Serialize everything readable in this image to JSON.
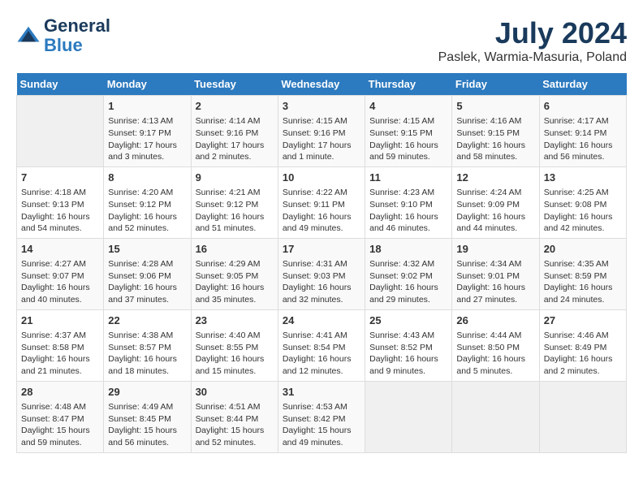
{
  "logo": {
    "line1": "General",
    "line2": "Blue"
  },
  "title": "July 2024",
  "location": "Paslek, Warmia-Masuria, Poland",
  "days_header": [
    "Sunday",
    "Monday",
    "Tuesday",
    "Wednesday",
    "Thursday",
    "Friday",
    "Saturday"
  ],
  "weeks": [
    [
      {
        "day": "",
        "info": ""
      },
      {
        "day": "1",
        "info": "Sunrise: 4:13 AM\nSunset: 9:17 PM\nDaylight: 17 hours\nand 3 minutes."
      },
      {
        "day": "2",
        "info": "Sunrise: 4:14 AM\nSunset: 9:16 PM\nDaylight: 17 hours\nand 2 minutes."
      },
      {
        "day": "3",
        "info": "Sunrise: 4:15 AM\nSunset: 9:16 PM\nDaylight: 17 hours\nand 1 minute."
      },
      {
        "day": "4",
        "info": "Sunrise: 4:15 AM\nSunset: 9:15 PM\nDaylight: 16 hours\nand 59 minutes."
      },
      {
        "day": "5",
        "info": "Sunrise: 4:16 AM\nSunset: 9:15 PM\nDaylight: 16 hours\nand 58 minutes."
      },
      {
        "day": "6",
        "info": "Sunrise: 4:17 AM\nSunset: 9:14 PM\nDaylight: 16 hours\nand 56 minutes."
      }
    ],
    [
      {
        "day": "7",
        "info": "Sunrise: 4:18 AM\nSunset: 9:13 PM\nDaylight: 16 hours\nand 54 minutes."
      },
      {
        "day": "8",
        "info": "Sunrise: 4:20 AM\nSunset: 9:12 PM\nDaylight: 16 hours\nand 52 minutes."
      },
      {
        "day": "9",
        "info": "Sunrise: 4:21 AM\nSunset: 9:12 PM\nDaylight: 16 hours\nand 51 minutes."
      },
      {
        "day": "10",
        "info": "Sunrise: 4:22 AM\nSunset: 9:11 PM\nDaylight: 16 hours\nand 49 minutes."
      },
      {
        "day": "11",
        "info": "Sunrise: 4:23 AM\nSunset: 9:10 PM\nDaylight: 16 hours\nand 46 minutes."
      },
      {
        "day": "12",
        "info": "Sunrise: 4:24 AM\nSunset: 9:09 PM\nDaylight: 16 hours\nand 44 minutes."
      },
      {
        "day": "13",
        "info": "Sunrise: 4:25 AM\nSunset: 9:08 PM\nDaylight: 16 hours\nand 42 minutes."
      }
    ],
    [
      {
        "day": "14",
        "info": "Sunrise: 4:27 AM\nSunset: 9:07 PM\nDaylight: 16 hours\nand 40 minutes."
      },
      {
        "day": "15",
        "info": "Sunrise: 4:28 AM\nSunset: 9:06 PM\nDaylight: 16 hours\nand 37 minutes."
      },
      {
        "day": "16",
        "info": "Sunrise: 4:29 AM\nSunset: 9:05 PM\nDaylight: 16 hours\nand 35 minutes."
      },
      {
        "day": "17",
        "info": "Sunrise: 4:31 AM\nSunset: 9:03 PM\nDaylight: 16 hours\nand 32 minutes."
      },
      {
        "day": "18",
        "info": "Sunrise: 4:32 AM\nSunset: 9:02 PM\nDaylight: 16 hours\nand 29 minutes."
      },
      {
        "day": "19",
        "info": "Sunrise: 4:34 AM\nSunset: 9:01 PM\nDaylight: 16 hours\nand 27 minutes."
      },
      {
        "day": "20",
        "info": "Sunrise: 4:35 AM\nSunset: 8:59 PM\nDaylight: 16 hours\nand 24 minutes."
      }
    ],
    [
      {
        "day": "21",
        "info": "Sunrise: 4:37 AM\nSunset: 8:58 PM\nDaylight: 16 hours\nand 21 minutes."
      },
      {
        "day": "22",
        "info": "Sunrise: 4:38 AM\nSunset: 8:57 PM\nDaylight: 16 hours\nand 18 minutes."
      },
      {
        "day": "23",
        "info": "Sunrise: 4:40 AM\nSunset: 8:55 PM\nDaylight: 16 hours\nand 15 minutes."
      },
      {
        "day": "24",
        "info": "Sunrise: 4:41 AM\nSunset: 8:54 PM\nDaylight: 16 hours\nand 12 minutes."
      },
      {
        "day": "25",
        "info": "Sunrise: 4:43 AM\nSunset: 8:52 PM\nDaylight: 16 hours\nand 9 minutes."
      },
      {
        "day": "26",
        "info": "Sunrise: 4:44 AM\nSunset: 8:50 PM\nDaylight: 16 hours\nand 5 minutes."
      },
      {
        "day": "27",
        "info": "Sunrise: 4:46 AM\nSunset: 8:49 PM\nDaylight: 16 hours\nand 2 minutes."
      }
    ],
    [
      {
        "day": "28",
        "info": "Sunrise: 4:48 AM\nSunset: 8:47 PM\nDaylight: 15 hours\nand 59 minutes."
      },
      {
        "day": "29",
        "info": "Sunrise: 4:49 AM\nSunset: 8:45 PM\nDaylight: 15 hours\nand 56 minutes."
      },
      {
        "day": "30",
        "info": "Sunrise: 4:51 AM\nSunset: 8:44 PM\nDaylight: 15 hours\nand 52 minutes."
      },
      {
        "day": "31",
        "info": "Sunrise: 4:53 AM\nSunset: 8:42 PM\nDaylight: 15 hours\nand 49 minutes."
      },
      {
        "day": "",
        "info": ""
      },
      {
        "day": "",
        "info": ""
      },
      {
        "day": "",
        "info": ""
      }
    ]
  ]
}
